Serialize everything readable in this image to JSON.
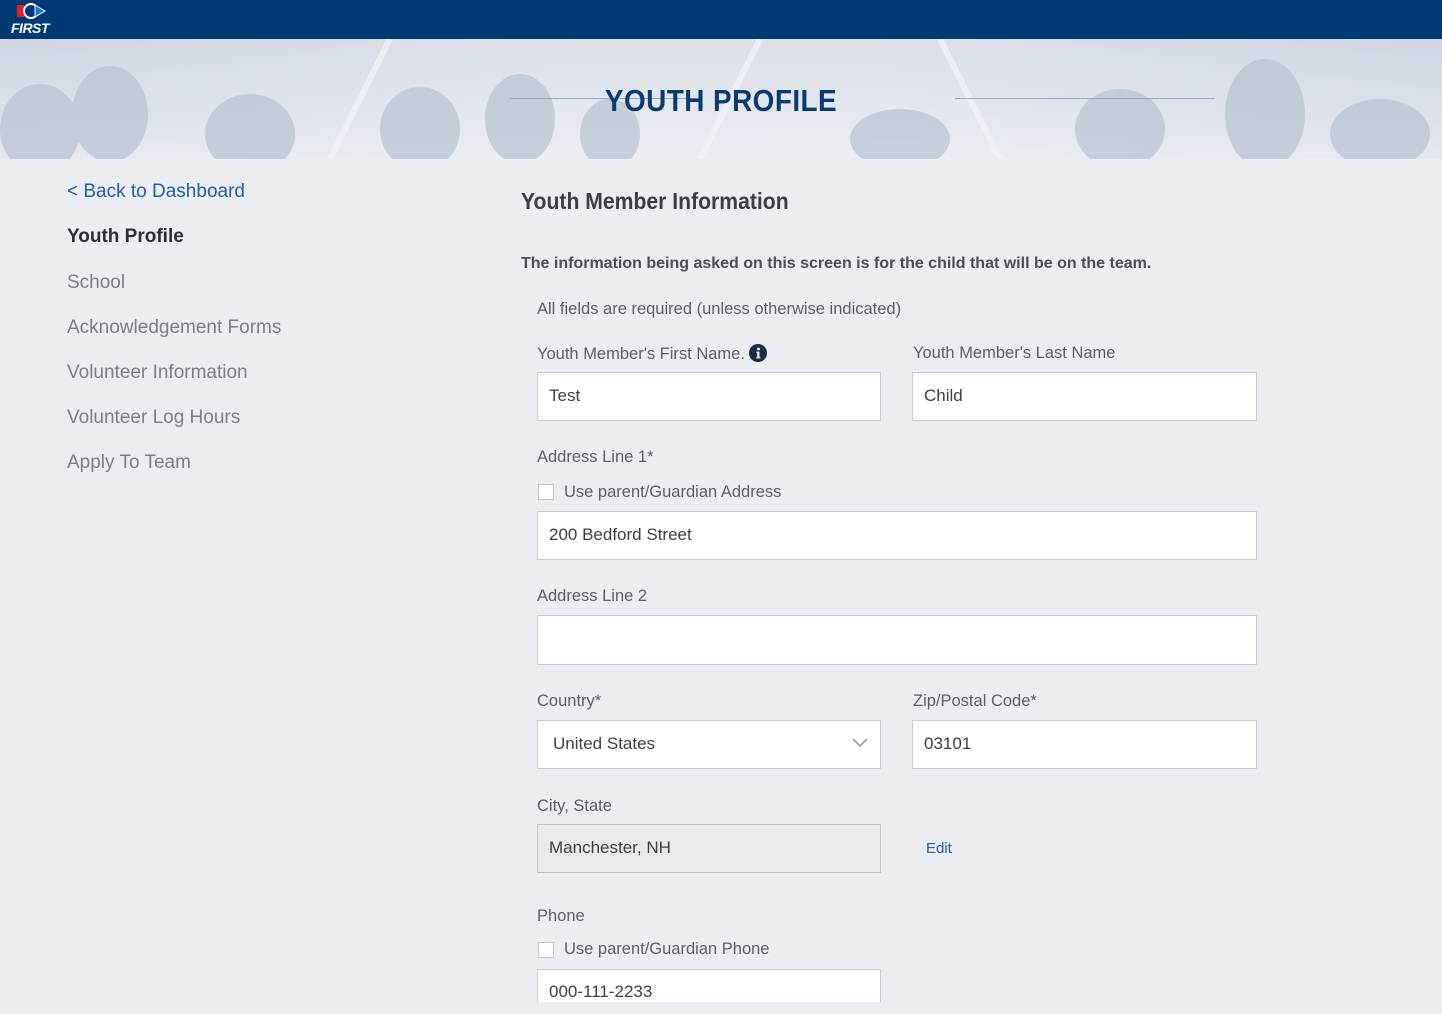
{
  "brand": {
    "logo_text": "FIRST"
  },
  "hero": {
    "title": "YOUTH PROFILE"
  },
  "sidebar": {
    "back_label": "< Back to Dashboard",
    "items": [
      {
        "label": "Youth Profile",
        "active": true
      },
      {
        "label": "School"
      },
      {
        "label": "Acknowledgement Forms"
      },
      {
        "label": "Volunteer Information"
      },
      {
        "label": "Volunteer Log Hours"
      },
      {
        "label": "Apply To Team"
      }
    ]
  },
  "form": {
    "heading": "Youth Member Information",
    "intro": "The information being asked on this screen is for the child that will be on the team.",
    "required_note": "All fields are required (unless otherwise indicated)",
    "first_name": {
      "label": "Youth Member's First Name.",
      "value": "Test"
    },
    "last_name": {
      "label": "Youth Member's Last Name",
      "value": "Child"
    },
    "address1": {
      "label": "Address Line 1*",
      "use_parent_label": "Use parent/Guardian Address",
      "value": "200 Bedford Street"
    },
    "address2": {
      "label": "Address Line 2",
      "value": ""
    },
    "country": {
      "label": "Country*",
      "value": "United States"
    },
    "zip": {
      "label": "Zip/Postal Code*",
      "value": "03101"
    },
    "city_state": {
      "label": "City, State",
      "value": "Manchester, NH",
      "edit_label": "Edit"
    },
    "phone": {
      "label": "Phone",
      "use_parent_label": "Use parent/Guardian Phone",
      "value": "000-111-2233"
    }
  },
  "colors": {
    "topbar": "#003a75",
    "link": "#1f5ea8",
    "hero_title": "#0b3a73"
  }
}
